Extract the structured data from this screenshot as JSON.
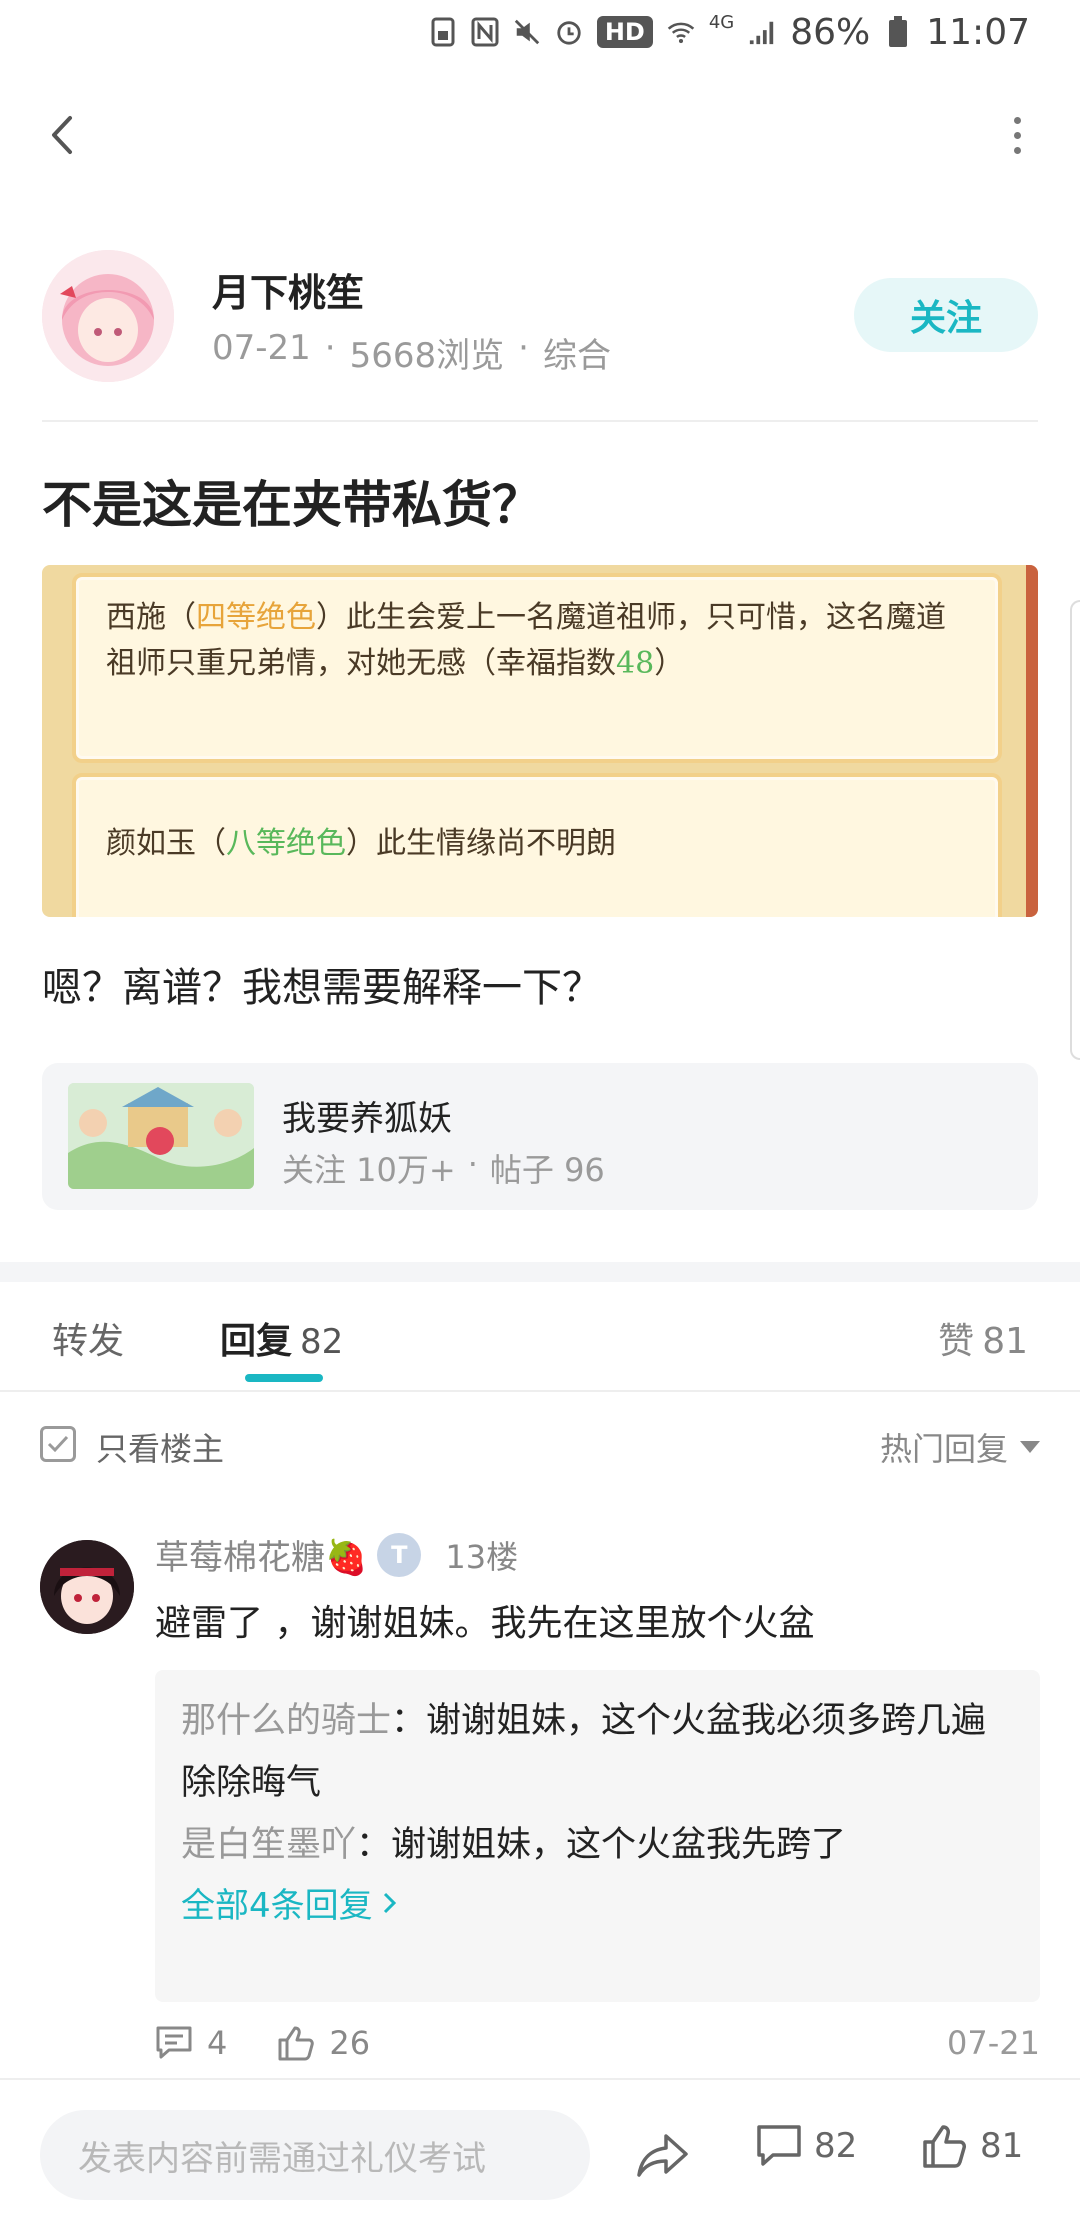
{
  "status_bar": {
    "battery": "86%",
    "time": "11:07",
    "hd": "HD",
    "net": "4G"
  },
  "author": {
    "name": "月下桃笙",
    "date": "07-21",
    "views": "5668浏览",
    "category": "综合",
    "follow_label": "关注"
  },
  "post": {
    "title": "不是这是在夹带私货？",
    "image_text": {
      "card1_a": "西施（",
      "card1_hl": "四等绝色",
      "card1_b": "）此生会爱上一名魔道祖师，只可惜，这名魔道祖师只重兄弟情，对她无感（幸福指数",
      "card1_num": "48",
      "card1_c": "）",
      "card2_a": "颜如玉（",
      "card2_hl": "八等绝色",
      "card2_b": "）此生情缘尚不明朗"
    },
    "body": "嗯？离谱？我想需要解释一下？"
  },
  "forum": {
    "name": "我要养狐妖",
    "followers": "关注 10万+",
    "posts": "帖子 96"
  },
  "tabs": {
    "repost": "转发",
    "reply": "回复",
    "reply_count": "82",
    "like": "赞",
    "like_count": "81"
  },
  "filter": {
    "only_op": "只看楼主",
    "sort": "热门回复"
  },
  "comment": {
    "name": "草莓棉花糖🍓",
    "badge": "T",
    "floor": "13楼",
    "text": "避雷了 ，谢谢姐妹。我先在这里放个火盆",
    "sub_replies": [
      {
        "who": "那什么的骑士",
        "text": "：谢谢姐妹，这个火盆我必须多跨几遍除除晦气"
      },
      {
        "who": "是白笙墨吖",
        "text": "：谢谢姐妹，这个火盆我先跨了"
      }
    ],
    "view_all": "全部4条回复",
    "reply_count": "4",
    "like_count": "26",
    "date": "07-21"
  },
  "bottom": {
    "placeholder": "发表内容前需通过礼仪考试",
    "comment_count": "82",
    "like_count": "81"
  },
  "colors": {
    "accent": "#1ab7c3",
    "muted": "#9a9a9a"
  }
}
